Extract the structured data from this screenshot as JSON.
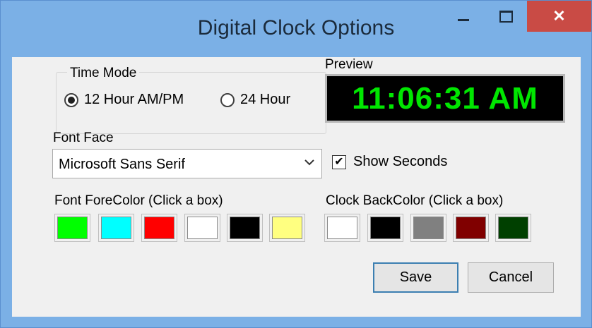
{
  "window": {
    "title": "Digital Clock Options",
    "controls": {
      "minimize": "minimize-icon",
      "maximize": "maximize-icon",
      "close": "close-icon",
      "close_label": "✕"
    }
  },
  "time_mode": {
    "group_label": "Time Mode",
    "options": [
      {
        "label": "12 Hour AM/PM",
        "selected": true
      },
      {
        "label": "24 Hour",
        "selected": false
      }
    ]
  },
  "preview": {
    "label": "Preview",
    "time_text": "11:06:31 AM",
    "fore_color": "#00e600",
    "back_color": "#000000"
  },
  "font_face": {
    "label": "Font Face",
    "value": "Microsoft Sans Serif"
  },
  "show_seconds": {
    "label": "Show Seconds",
    "checked": true,
    "check_mark": "✔"
  },
  "fore_colors": {
    "label": "Font ForeColor (Click a box)",
    "swatches": [
      "#00ff00",
      "#00ffff",
      "#ff0000",
      "#ffffff",
      "#000000",
      "#ffff80"
    ]
  },
  "back_colors": {
    "label": "Clock BackColor (Click a box)",
    "swatches": [
      "#ffffff",
      "#000000",
      "#808080",
      "#800000",
      "#004000"
    ]
  },
  "buttons": {
    "save": "Save",
    "cancel": "Cancel"
  }
}
